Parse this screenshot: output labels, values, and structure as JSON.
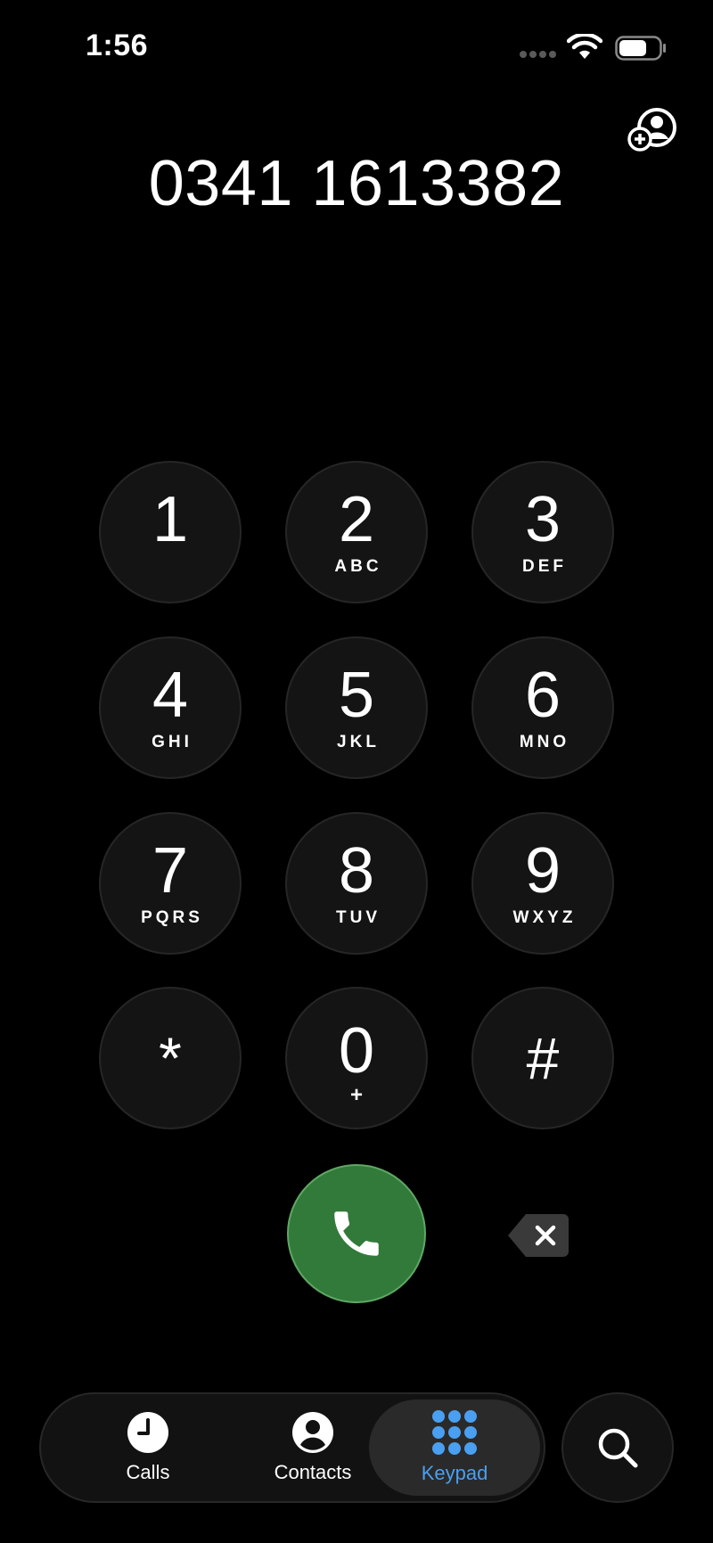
{
  "status_bar": {
    "time": "1:56"
  },
  "dialer": {
    "number": "0341 1613382"
  },
  "keypad": {
    "keys": [
      {
        "digit": "1",
        "letters": ""
      },
      {
        "digit": "2",
        "letters": "ABC"
      },
      {
        "digit": "3",
        "letters": "DEF"
      },
      {
        "digit": "4",
        "letters": "GHI"
      },
      {
        "digit": "5",
        "letters": "JKL"
      },
      {
        "digit": "6",
        "letters": "MNO"
      },
      {
        "digit": "7",
        "letters": "PQRS"
      },
      {
        "digit": "8",
        "letters": "TUV"
      },
      {
        "digit": "9",
        "letters": "WXYZ"
      },
      {
        "digit": "*",
        "letters": ""
      },
      {
        "digit": "0",
        "letters": "+"
      },
      {
        "digit": "#",
        "letters": ""
      }
    ]
  },
  "tab_bar": {
    "tabs": [
      {
        "label": "Calls",
        "icon": "clock-icon"
      },
      {
        "label": "Contacts",
        "icon": "person-icon"
      },
      {
        "label": "Keypad",
        "icon": "keypad-icon",
        "selected": true
      }
    ]
  },
  "colors": {
    "accent": "#4a9ff0",
    "call_green": "#327a3a",
    "key_background": "#141414"
  }
}
